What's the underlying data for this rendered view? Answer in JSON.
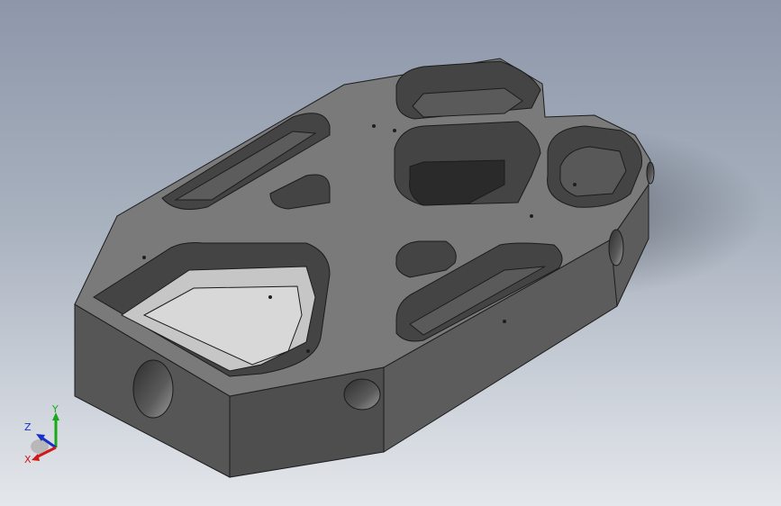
{
  "viewport": {
    "background_top": "#8d97a9",
    "background_bottom": "#e4e7eb"
  },
  "model": {
    "top_face_color": "#787878",
    "side_face_color": "#5f5f5f",
    "front_face_color": "#535353",
    "pocket_color": "#3f3f3f"
  },
  "triad": {
    "x_label": "X",
    "y_label": "Y",
    "z_label": "Z",
    "x_color": "#d01818",
    "y_color": "#18a818",
    "z_color": "#1830c8"
  }
}
